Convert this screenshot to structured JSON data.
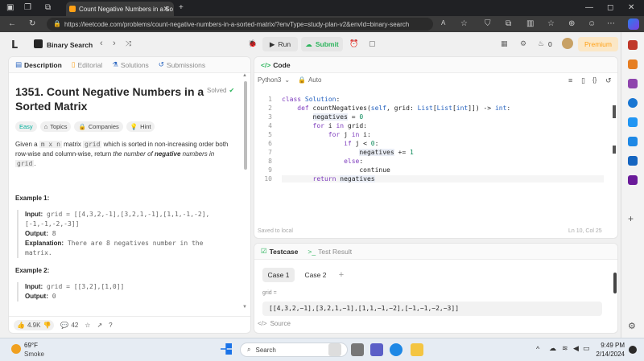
{
  "browser": {
    "tab_title": "Count Negative Numbers in a So",
    "url": "https://leetcode.com/problems/count-negative-numbers-in-a-sorted-matrix/?envType=study-plan-v2&envId=binary-search"
  },
  "header": {
    "study_plan": "Binary Search",
    "run_label": "Run",
    "submit_label": "Submit",
    "streak_count": "0",
    "premium_label": "Premium"
  },
  "left_panel": {
    "tabs": [
      "Description",
      "Editorial",
      "Solutions",
      "Submissions"
    ],
    "title_line1": "1351. Count Negative Numbers in a",
    "title_line2": "Sorted Matrix",
    "solved_label": "Solved",
    "tags": [
      "Easy",
      "Topics",
      "Companies",
      "Hint"
    ],
    "desc_pre": "Given a ",
    "desc_mxn": "m x n",
    "desc_mid": " matrix ",
    "desc_grid": "grid",
    "desc_post": " which is sorted in non-increasing order both",
    "desc_line2a": "row-wise and column-wise, return ",
    "desc_line2b": "the number of ",
    "desc_line2c": "negative",
    "desc_line2d": " numbers in",
    "desc_line3_grid": "grid",
    "desc_line3_end": ".",
    "example1_title": "Example 1:",
    "example1_input_label": "Input:",
    "example1_input_1": " grid = [[4,3,2,-1],[3,2,1,-1],[1,1,-1,-2],",
    "example1_input_2": "[-1,-1,-2,-3]]",
    "example1_output_label": "Output:",
    "example1_output": " 8",
    "example1_expl_label": "Explanation:",
    "example1_expl_1": " There are 8 negatives number in the",
    "example1_expl_2": "matrix.",
    "example2_title": "Example 2:",
    "example2_input_label": "Input:",
    "example2_input": " grid = [[3,2],[1,0]]",
    "example2_output_label": "Output:",
    "example2_output": " 0",
    "likes": "4.9K",
    "comments": "42"
  },
  "code_panel": {
    "title": "Code",
    "language": "Python3",
    "auto_label": "Auto",
    "lines": [
      "class Solution:",
      "    def countNegatives(self, grid: List[List[int]]) -> int:",
      "        negatives = 0",
      "        for i in grid:",
      "            for j in i:",
      "                if j < 0:",
      "                    negatives += 1",
      "                else:",
      "                    continue",
      "        return negatives"
    ],
    "line_numbers": [
      "1",
      "2",
      "3",
      "4",
      "5",
      "6",
      "7",
      "8",
      "9",
      "10"
    ],
    "saved": "Saved to local",
    "cursor": "Ln 10, Col 25"
  },
  "test_panel": {
    "tab_testcase": "Testcase",
    "tab_result": "Test Result",
    "case1": "Case 1",
    "case2": "Case 2",
    "add": "+",
    "grid_label": "grid =",
    "grid_value": "[[4,3,2,−1],[3,2,1,−1],[1,1,−1,−2],[−1,−1,−2,−3]]",
    "source": "Source"
  },
  "taskbar": {
    "temperature": "69°F",
    "weather": "Smoke",
    "search": "Search",
    "time": "9:49 PM",
    "date": "2/14/2024"
  }
}
